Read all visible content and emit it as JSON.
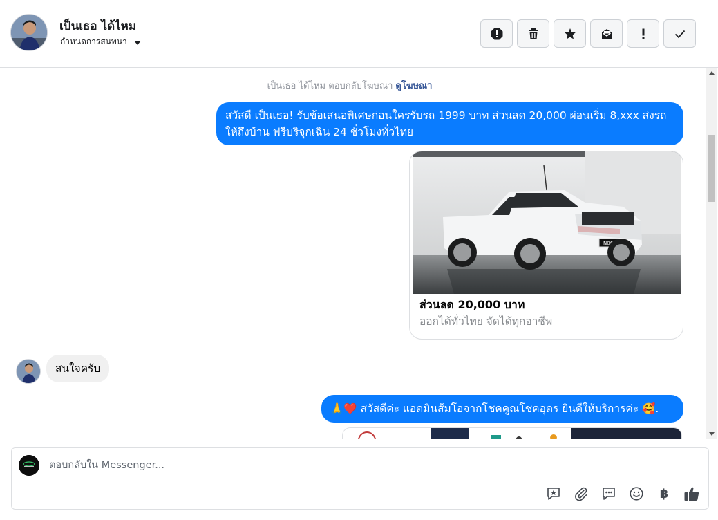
{
  "header": {
    "contact_name": "เป็นเธอ ได้ไหม",
    "settings_label": "กำหนดการสนทนา",
    "toolbar": [
      {
        "name": "spam-button",
        "icon": "alert-circle-icon"
      },
      {
        "name": "delete-button",
        "icon": "trash-icon"
      },
      {
        "name": "star-button",
        "icon": "star-icon"
      },
      {
        "name": "mark-unread-button",
        "icon": "envelope-icon"
      },
      {
        "name": "important-button",
        "icon": "exclamation-icon"
      },
      {
        "name": "done-button",
        "icon": "check-icon"
      }
    ]
  },
  "chat": {
    "ad_reply_prefix": "เป็นเธอ ได้ไหม ตอบกลับโฆษณา",
    "ad_reply_link": "ดูโฆษณา",
    "messages": [
      {
        "direction": "out",
        "text": "สวัสดี เป็นเธอ! รับข้อเสนอพิเศษก่อนใครรับรถ 1999 บาท ส่วนลด 20,000 ผ่อนเริ่ม 8,xxx ส่งรถให้ถึงบ้าน ฟรีบริจุกเฉิน 24 ชั่วโมงทั่วไทย"
      },
      {
        "direction": "in",
        "text": "สนใจครับ"
      },
      {
        "direction": "out",
        "text": "🙏❤️ สวัสดีค่ะ แอดมินส้มโอจากโชคคูณโชคอุดร ยินดีให้บริการค่ะ 🥰."
      }
    ],
    "card": {
      "title": "ส่วนลด 20,000 บาท",
      "subtitle": "ออกได้ทั่วไทย จัดได้ทุกอาชีพ",
      "plate": "N066"
    }
  },
  "composer": {
    "placeholder": "ตอบกลับใน Messenger..."
  },
  "colors": {
    "outgoing_bubble": "#0a7cff",
    "incoming_bubble": "#f0f0f0",
    "link": "#385898"
  }
}
